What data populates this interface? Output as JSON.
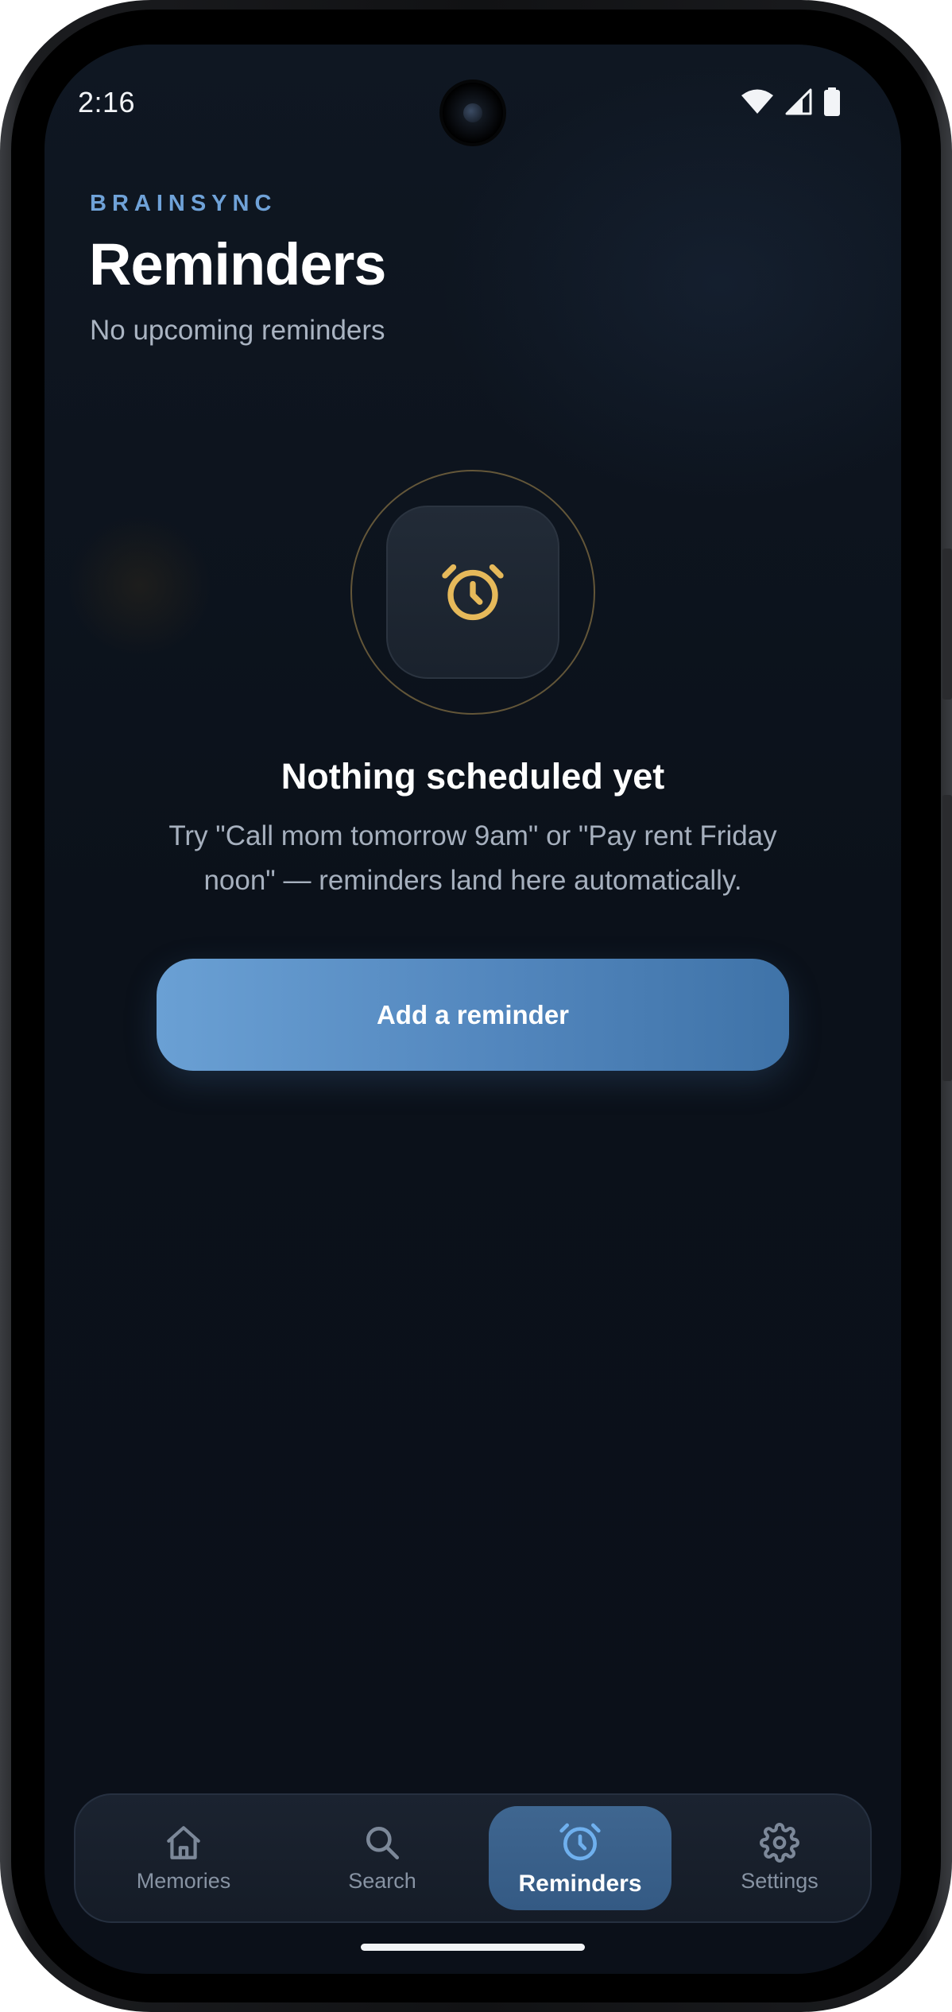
{
  "status_bar": {
    "time": "2:16"
  },
  "header": {
    "brand": "BRAINSYNC",
    "title": "Reminders",
    "subtitle": "No upcoming reminders"
  },
  "empty_state": {
    "icon": "alarm-clock-icon",
    "title": "Nothing scheduled yet",
    "description": "Try \"Call mom tomorrow 9am\" or \"Pay rent Friday noon\" — reminders land here automatically.",
    "button_label": "Add a reminder"
  },
  "bottom_nav": {
    "items": [
      {
        "label": "Memories",
        "icon": "home-icon",
        "active": false
      },
      {
        "label": "Search",
        "icon": "search-icon",
        "active": false
      },
      {
        "label": "Reminders",
        "icon": "alarm-clock-icon",
        "active": true
      },
      {
        "label": "Settings",
        "icon": "gear-icon",
        "active": false
      }
    ]
  },
  "colors": {
    "accent": "#6fa2d8",
    "alarm_icon": "#e6b95a",
    "background": "#0b111a"
  }
}
